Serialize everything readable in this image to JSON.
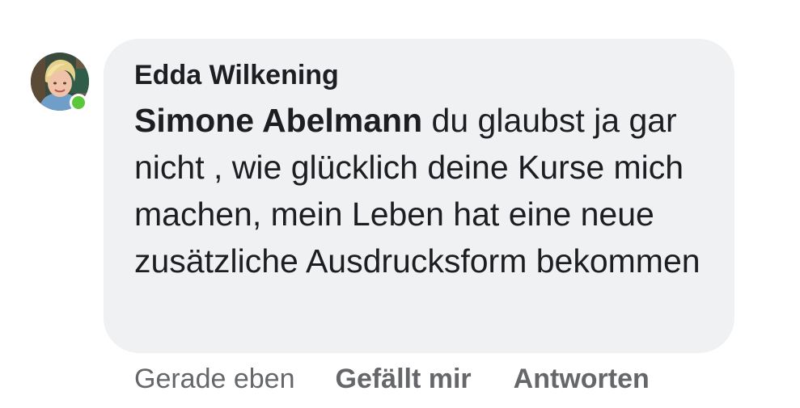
{
  "comment": {
    "author": "Edda Wilkening",
    "mention": "Simone Abelmann",
    "text": " du glaubst ja gar nicht , wie glücklich deine Kurse mich machen, mein Leben hat eine neue zusätzliche Ausdrucksform bekommen",
    "timestamp": "Gerade eben",
    "like_label": "Gefällt mir",
    "reply_label": "Antworten"
  },
  "status": {
    "online": true,
    "online_color": "#5ac83a"
  },
  "colors": {
    "bubble_background": "#f0f1f3",
    "text": "#1c1e21",
    "secondary_text": "#65676b"
  }
}
